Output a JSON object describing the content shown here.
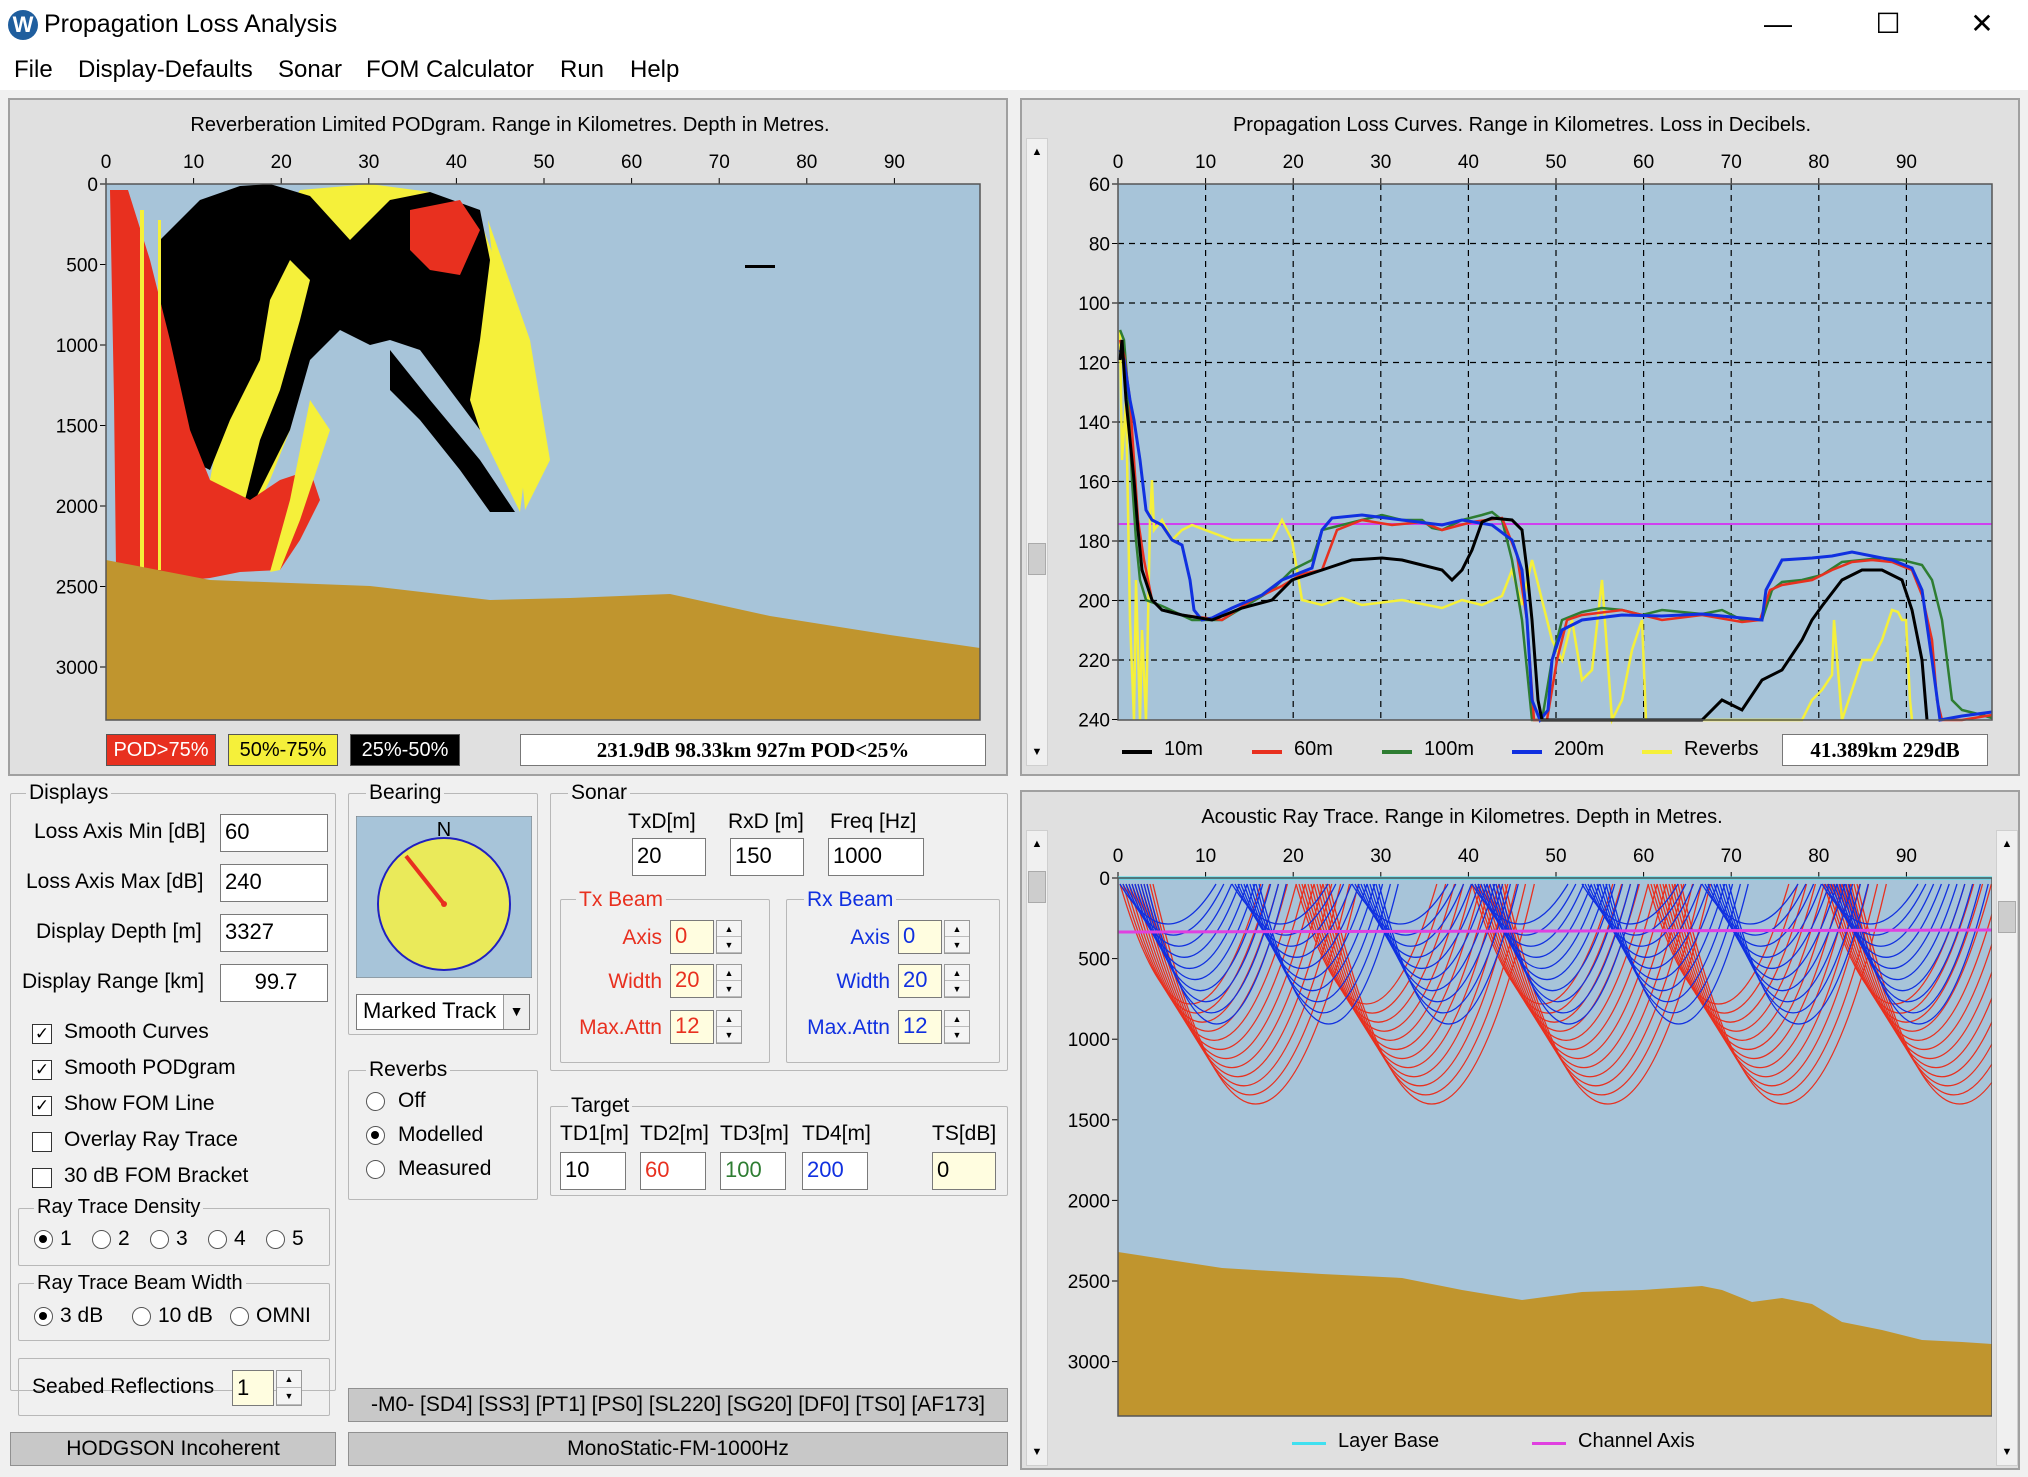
{
  "window": {
    "title": "Propagation Loss Analysis",
    "icon_letter": "W",
    "minimize": "—",
    "maximize": "☐",
    "close": "✕"
  },
  "menu": [
    "File",
    "Display-Defaults",
    "Sonar",
    "FOM Calculator",
    "Run",
    "Help"
  ],
  "podgram": {
    "title": "Reverberation Limited PODgram. Range in Kilometres. Depth in Metres.",
    "x_ticks": [
      "0",
      "10",
      "20",
      "30",
      "40",
      "50",
      "60",
      "70",
      "80",
      "90"
    ],
    "y_ticks": [
      "0",
      "500",
      "1000",
      "1500",
      "2000",
      "2500",
      "3000"
    ],
    "legend": [
      {
        "label": "POD>75%",
        "bg": "#e8301f",
        "fg": "#ffffff"
      },
      {
        "label": "50%-75%",
        "bg": "#f5f03a",
        "fg": "#000000"
      },
      {
        "label": "25%-50%",
        "bg": "#000000",
        "fg": "#ffffff"
      }
    ],
    "readout": "231.9dB   98.33km 927m POD<25%"
  },
  "loss_curves": {
    "title": "Propagation Loss Curves. Range in Kilometres. Loss in Decibels.",
    "x_ticks": [
      "0",
      "10",
      "20",
      "30",
      "40",
      "50",
      "60",
      "70",
      "80",
      "90"
    ],
    "y_ticks": [
      "60",
      "80",
      "100",
      "120",
      "140",
      "160",
      "180",
      "200",
      "220",
      "240"
    ],
    "legend": [
      {
        "label": "10m",
        "color": "#000000"
      },
      {
        "label": "60m",
        "color": "#e8301f"
      },
      {
        "label": "100m",
        "color": "#2e7d32"
      },
      {
        "label": "200m",
        "color": "#1030e0"
      },
      {
        "label": "Reverbs",
        "color": "#f5f03a"
      }
    ],
    "readout": "41.389km 229dB"
  },
  "ray_trace": {
    "title": "Acoustic Ray Trace. Range in Kilometres. Depth in Metres.",
    "x_ticks": [
      "0",
      "10",
      "20",
      "30",
      "40",
      "50",
      "60",
      "70",
      "80",
      "90"
    ],
    "y_ticks": [
      "0",
      "500",
      "1000",
      "1500",
      "2000",
      "2500",
      "3000"
    ],
    "legend": [
      {
        "label": "Layer Base",
        "color": "#40e0f0"
      },
      {
        "label": "Channel Axis",
        "color": "#e040e0"
      }
    ]
  },
  "displays": {
    "title": "Displays",
    "fields": [
      {
        "label": "Loss Axis Min [dB]",
        "value": "60"
      },
      {
        "label": "Loss Axis Max [dB]",
        "value": "240"
      },
      {
        "label": "Display Depth [m]",
        "value": "3327"
      },
      {
        "label": "Display Range [km]",
        "value": "99.7"
      }
    ],
    "checks": [
      {
        "label": "Smooth Curves",
        "checked": true
      },
      {
        "label": "Smooth PODgram",
        "checked": true
      },
      {
        "label": "Show FOM Line",
        "checked": true
      },
      {
        "label": "Overlay Ray Trace",
        "checked": false
      },
      {
        "label": "30 dB FOM Bracket",
        "checked": false
      }
    ],
    "density_title": "Ray Trace Density",
    "density": [
      "1",
      "2",
      "3",
      "4",
      "5"
    ],
    "beamwidth_title": "Ray Trace Beam Width",
    "beamwidth": [
      "3 dB",
      "10 dB",
      "OMNI"
    ],
    "seabed_label": "Seabed Reflections",
    "seabed_value": "1"
  },
  "bearing": {
    "title": "Bearing",
    "north": "N",
    "select": "Marked Track"
  },
  "reverbs": {
    "title": "Reverbs",
    "options": [
      "Off",
      "Modelled",
      "Measured"
    ]
  },
  "sonar": {
    "title": "Sonar",
    "txd_label": "TxD[m]",
    "txd": "20",
    "rxd_label": "RxD [m]",
    "rxd": "150",
    "freq_label": "Freq [Hz]",
    "freq": "1000",
    "tx_title": "Tx Beam",
    "rx_title": "Rx Beam",
    "axis_label": "Axis",
    "width_label": "Width",
    "maxattn_label": "Max.Attn",
    "tx": {
      "axis": "0",
      "width": "20",
      "maxattn": "12"
    },
    "rx": {
      "axis": "0",
      "width": "20",
      "maxattn": "12"
    }
  },
  "target": {
    "title": "Target",
    "labels": [
      "TD1[m]",
      "TD2[m]",
      "TD3[m]",
      "TD4[m]",
      "TS[dB]"
    ],
    "values": [
      "10",
      "60",
      "100",
      "200",
      "0"
    ]
  },
  "status": {
    "params": "-M0-  [SD4] [SS3] [PT1] [PS0] [SL220] [SG20] [DF0] [TS0] [AF173]",
    "model": "HODGSON Incoherent",
    "mode": "MonoStatic-FM-1000Hz"
  }
}
